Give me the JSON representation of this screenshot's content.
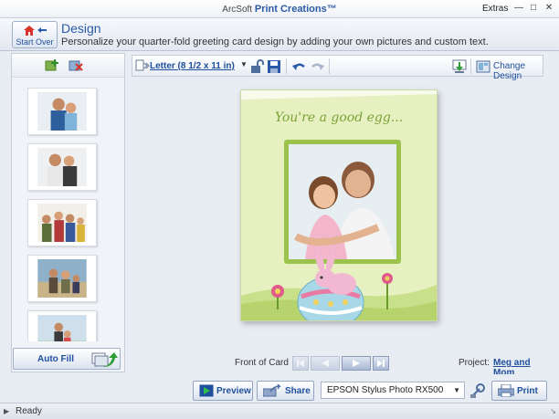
{
  "window": {
    "brand": "ArcSoft",
    "app_name": "Print Creations™",
    "menu_extras": "Extras"
  },
  "header": {
    "start_over_label": "Start Over",
    "title": "Design",
    "subtitle": "Personalize your quarter-fold greeting card design by adding your own pictures and custom text."
  },
  "left_panel": {
    "add_photo_icon": "add-photo-icon",
    "remove_photo_icon": "remove-photo-icon",
    "thumbnails": [
      "photo-1",
      "photo-2",
      "photo-3",
      "photo-4",
      "photo-5"
    ],
    "auto_fill_label": "Auto Fill"
  },
  "toolbar": {
    "paper_size": "Letter (8 1/2 x 11 in)",
    "change_design_label": "Change Design"
  },
  "card": {
    "greeting": "You're a good egg..."
  },
  "nav": {
    "front_of_card": "Front of Card",
    "project_label": "Project:",
    "project_name": "Meg and Mom"
  },
  "bottom": {
    "preview_label": "Preview",
    "share_label": "Share",
    "printer": "EPSON Stylus Photo RX500",
    "print_label": "Print"
  },
  "status": {
    "text": "Ready"
  },
  "colors": {
    "accent": "#1e4f9c",
    "card_background": "#e7f0c0",
    "greeting_text": "#7aa33a"
  }
}
